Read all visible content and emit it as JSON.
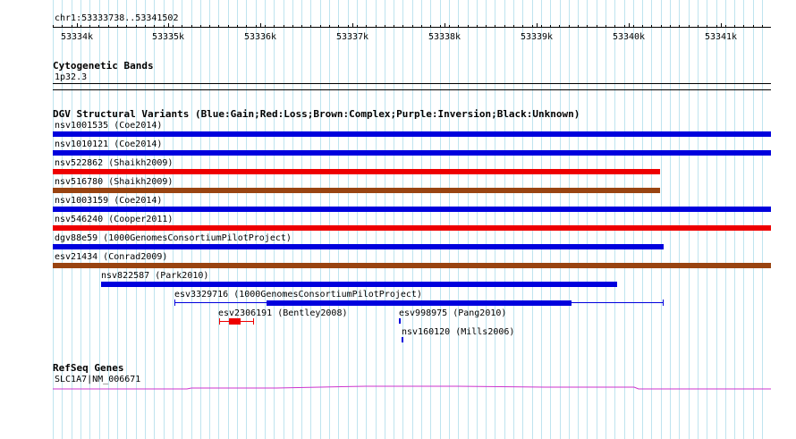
{
  "ruler": {
    "coords": "chr1:53333738..53341502",
    "ticks": [
      "53334k",
      "53335k",
      "53336k",
      "53337k",
      "53338k",
      "53339k",
      "53340k",
      "53341k"
    ]
  },
  "cytoband": {
    "title": "Cytogenetic Bands",
    "band": "1p32.3"
  },
  "dgv": {
    "title": "DGV Structural Variants (Blue:Gain;Red:Loss;Brown:Complex;Purple:Inversion;Black:Unknown)",
    "features": [
      {
        "label": "nsv1001535 (Coe2014)",
        "color": "#0000dd"
      },
      {
        "label": "nsv1010121 (Coe2014)",
        "color": "#0000dd"
      },
      {
        "label": "nsv522862 (Shaikh2009)",
        "color": "#ee0000"
      },
      {
        "label": "nsv516780 (Shaikh2009)",
        "color": "#994411"
      },
      {
        "label": "nsv1003159 (Coe2014)",
        "color": "#0000dd"
      },
      {
        "label": "nsv546240 (Cooper2011)",
        "color": "#ee0000"
      },
      {
        "label": "dgv88e59 (1000GenomesConsortiumPilotProject)",
        "color": "#0000dd"
      },
      {
        "label": "esv21434 (Conrad2009)",
        "color": "#994411"
      },
      {
        "label": "nsv822587 (Park2010)",
        "color": "#0000dd"
      },
      {
        "label": "esv3329716 (1000GenomesConsortiumPilotProject)",
        "color": "#0000dd"
      },
      {
        "label": "esv2306191 (Bentley2008)",
        "color": "#ee0000"
      },
      {
        "label": "esv998975 (Pang2010)",
        "color": "#0000dd"
      },
      {
        "label": "nsv160120 (Mills2006)",
        "color": "#0000dd"
      }
    ]
  },
  "refseq": {
    "title": "RefSeq Genes",
    "gene_label": "SLC1A7|NM_006671",
    "color": "#cc33cc"
  }
}
